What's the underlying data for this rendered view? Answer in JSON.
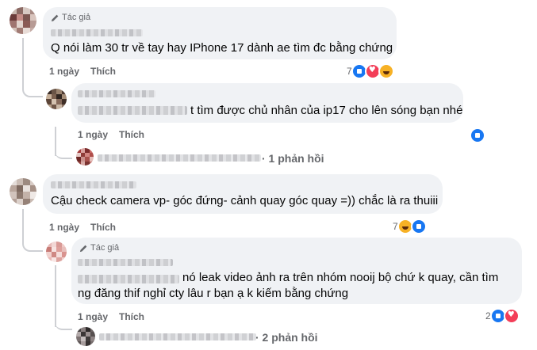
{
  "author_badge_label": "Tác giả",
  "like_label": "Thích",
  "comments": [
    {
      "text": "Q nói làm 30 tr về tay hay IPhone 17 dành ae tìm đc bằng chứng",
      "time": "1 ngày",
      "reaction_count": "7",
      "reactions": [
        "like-icon",
        "love-icon",
        "haha-icon"
      ],
      "reply": {
        "text": "t tìm được chủ nhân của ip17 cho lên sóng bạn nhé",
        "time": "1 ngày"
      },
      "more_replies": "· 1 phản hồi"
    },
    {
      "text": "Cậu check camera vp- góc đứng- cảnh quay góc quay =)) chắc là ra thuiii",
      "time": "1 ngày",
      "reaction_count": "7",
      "reactions": [
        "haha-icon",
        "like-icon"
      ],
      "reply": {
        "text_line1": "nó leak video ảnh ra trên nhóm nooij bộ chứ k quay, cần tìm",
        "text_line2": "ng đăng thif nghỉ cty lâu r bạn ạ k kiếm bằng chứng",
        "time": "1 ngày",
        "reaction_count": "2"
      },
      "more_replies": "· 2 phản hồi"
    }
  ],
  "colors": {
    "bubble": "#f0f2f5",
    "meta": "#65676b",
    "like": "#1877f2",
    "love": "#f33e58",
    "haha": "#f7b125"
  }
}
